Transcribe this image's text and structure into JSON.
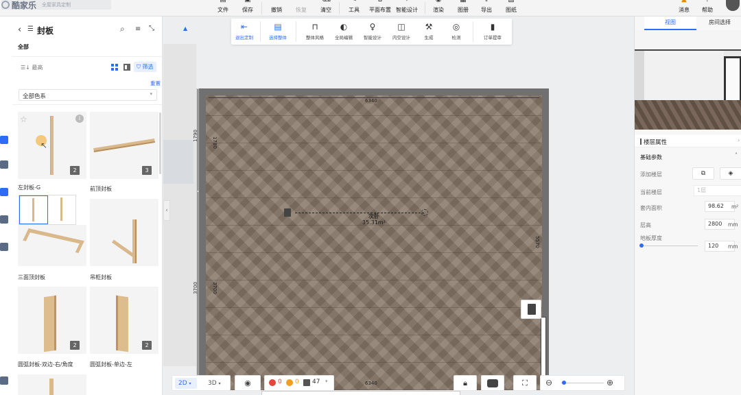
{
  "app": {
    "logo_text": "酷家乐",
    "subtitle": "全屋家具定制"
  },
  "toolbar": {
    "items": [
      {
        "label": "文件",
        "icon": "file-icon"
      },
      {
        "label": "保存",
        "icon": "save-icon"
      },
      {
        "label": "撤销",
        "icon": "undo-icon"
      },
      {
        "label": "恢复",
        "icon": "redo-icon"
      },
      {
        "label": "清空",
        "icon": "clear-icon"
      },
      {
        "label": "工具",
        "icon": "tool-icon"
      },
      {
        "label": "平面布置",
        "icon": "layout-icon"
      },
      {
        "label": "智能设计",
        "icon": "smart-design-icon"
      },
      {
        "label": "渲染",
        "icon": "render-icon"
      },
      {
        "label": "图册",
        "icon": "album-icon"
      },
      {
        "label": "导出",
        "icon": "export-icon"
      },
      {
        "label": "图纸",
        "icon": "drawing-icon"
      }
    ],
    "right": [
      {
        "label": "消息",
        "icon": "message-icon"
      },
      {
        "label": "帮助",
        "icon": "help-icon"
      }
    ]
  },
  "subtoolbar": {
    "items": [
      {
        "label": "退出定制"
      },
      {
        "label": "选择整体"
      },
      {
        "label": "整体风格"
      },
      {
        "label": "全局编辑"
      },
      {
        "label": "智能设计"
      },
      {
        "label": "内空设计"
      },
      {
        "label": "生成"
      },
      {
        "label": "检测"
      },
      {
        "label": "订单提审"
      }
    ]
  },
  "panel": {
    "title": "封板",
    "category": "全部",
    "sort_label": "最高",
    "filter_label": "筛选",
    "reset_label": "重置",
    "color_select": "全部色系",
    "products": [
      {
        "name": "左封板-G",
        "badge": "2"
      },
      {
        "name": "前顶封板",
        "badge": "3"
      },
      {
        "name": "三面顶封板",
        "badge": ""
      },
      {
        "name": "吊柜封板",
        "badge": ""
      },
      {
        "name": "圆弧封板-双边-右/角度",
        "badge": "2"
      },
      {
        "name": "圆弧封板-单边-左",
        "badge": "2"
      }
    ]
  },
  "canvas": {
    "room_name": "次卧",
    "room_area": "35.31m²",
    "dim_top": "6340",
    "dim_bottom": "6340",
    "dim_left_upper": "1790",
    "dim_left_lower": "3700",
    "dim_inner_left_upper": "1780",
    "dim_inner_left_lower": "3700",
    "dim_right": "5570"
  },
  "bottombar": {
    "view2d": "2D",
    "view3d": "3D",
    "error_count": "0",
    "warning_count": "0",
    "item_count": "47"
  },
  "rpanel": {
    "tabs": [
      "视图",
      "房间选择"
    ],
    "section_title": "楼层属性",
    "group_title": "基础参数",
    "add_floor_label": "添加楼层",
    "current_floor_label": "当前楼层",
    "current_floor_value": "1层",
    "area_label": "套内面积",
    "area_value": "98.62",
    "area_unit": "m²",
    "height_label": "层高",
    "height_value": "2800",
    "height_unit": "mm",
    "thickness_label": "地板厚度",
    "thickness_value": "120",
    "thickness_unit": "mm"
  },
  "colors": {
    "accent": "#2f6cf6",
    "wall": "#6b6b6b",
    "floor": "#86776a"
  }
}
